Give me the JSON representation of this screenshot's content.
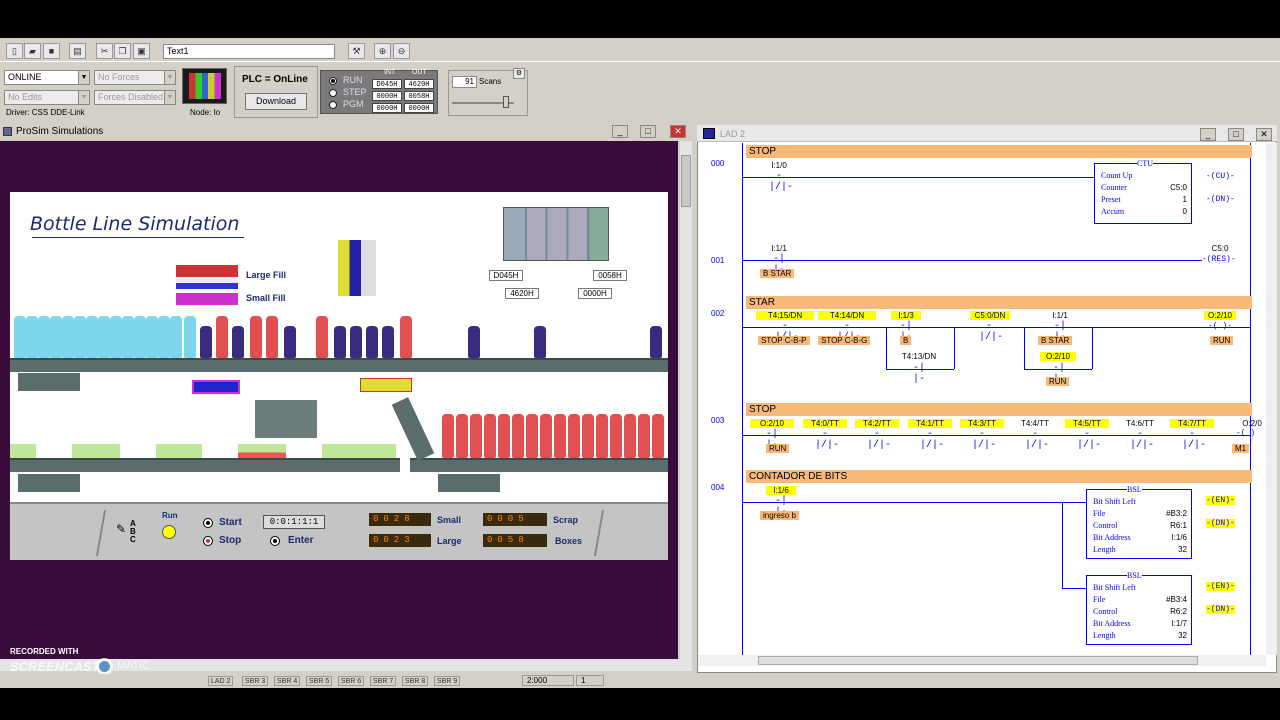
{
  "toolbar": {
    "text_field": "Text1"
  },
  "controls": {
    "mode": "ONLINE",
    "forces": "No Forces",
    "edits": "No Edits",
    "forces_disabled": "Forces Disabled",
    "driver": "Driver: CSS DDE-Link",
    "node": "Node: Io",
    "plc_status": "PLC = OnLine",
    "download": "Download",
    "modes": [
      "RUN",
      "STEP",
      "PGM"
    ],
    "in_label": "INT",
    "out_label": "OUT",
    "io": [
      [
        "D045H",
        "4620H"
      ],
      [
        "0000H",
        "0058H"
      ],
      [
        "0000H",
        "0000H"
      ]
    ],
    "scans": "91",
    "scans_label": "Scans"
  },
  "sim": {
    "window_title": "ProSim Simulations",
    "title": "Bottle Line Simulation",
    "large_fill": "Large Fill",
    "small_fill": "Small Fill",
    "plc_labels": [
      "D045H",
      "0058H",
      "4620H",
      "0000H"
    ],
    "run": "Run",
    "start": "Start",
    "stop": "Stop",
    "enter": "Enter",
    "small": "Small",
    "large": "Large",
    "scrap": "Scrap",
    "boxes": "Boxes",
    "small_count": "0028",
    "large_count": "0023",
    "scrap_count": "0005",
    "boxes_count": "0058",
    "entry": "0:0:1:1:1",
    "abc": "A B C",
    "recorded": "RECORDED WITH",
    "screencast": "SCREENCAST",
    "matic": "MATIC"
  },
  "lad": {
    "window_title": "LAD 2",
    "r000": {
      "num": "000",
      "comment": "STOP",
      "c1": "I:1/0",
      "ctu": "CTU",
      "count_up": "Count Up",
      "counter": "Counter",
      "counter_val": "C5:0",
      "preset": "Preset",
      "preset_val": "1",
      "accum": "Accum",
      "accum_val": "0",
      "cu": "CU",
      "dn": "DN"
    },
    "r001": {
      "num": "001",
      "c1": "I:1/1",
      "lbl1": "B STAR",
      "coil_addr": "C5:0",
      "coil": "RES"
    },
    "r002": {
      "num": "002",
      "comment": "STAR",
      "a1": "T4:15/DN",
      "a2": "T4:14/DN",
      "a3": "I:1/3",
      "a4": "C5:0/DN",
      "a5": "I:1/1",
      "a6": "O:2/10",
      "l1": "STOP C-B-P",
      "l2": "STOP C-B-G",
      "l3": "B",
      "a7": "T4:13/DN",
      "l5": "B STAR",
      "a8": "O:2/10",
      "l6": "RUN",
      "l7": "RUN"
    },
    "r003": {
      "num": "003",
      "comment": "STOP",
      "a": [
        "O:2/10",
        "T4:0/TT",
        "T4:2/TT",
        "T4:1/TT",
        "T4:3/TT",
        "T4:4/TT",
        "T4:5/TT",
        "T4:6/TT",
        "T4:7/TT"
      ],
      "coil": "O:2/0",
      "l1": "RUN",
      "l2": "M1"
    },
    "r004": {
      "num": "004",
      "comment": "CONTADOR DE BITS",
      "a1": "I:1/6",
      "l1": "ingreso b",
      "bsl": "BSL",
      "title": "Bit Shift Left",
      "file": "File",
      "file1": "#B3:2",
      "file2": "#B3:4",
      "control": "Control",
      "control1": "R6:1",
      "control2": "R6:2",
      "bitaddr": "Bit Address",
      "bit1": "I:1/6",
      "bit2": "I:1/7",
      "length": "Length",
      "len1": "32",
      "len2": "32",
      "en": "EN",
      "dn": "DN"
    }
  },
  "status": {
    "tabs": [
      "LAD 2",
      "SBR 3",
      "SBR 4",
      "SBR 5",
      "SBR 6",
      "SBR 7",
      "SBR 8",
      "SBR 9"
    ],
    "pos": "2:000",
    "num": "1"
  }
}
